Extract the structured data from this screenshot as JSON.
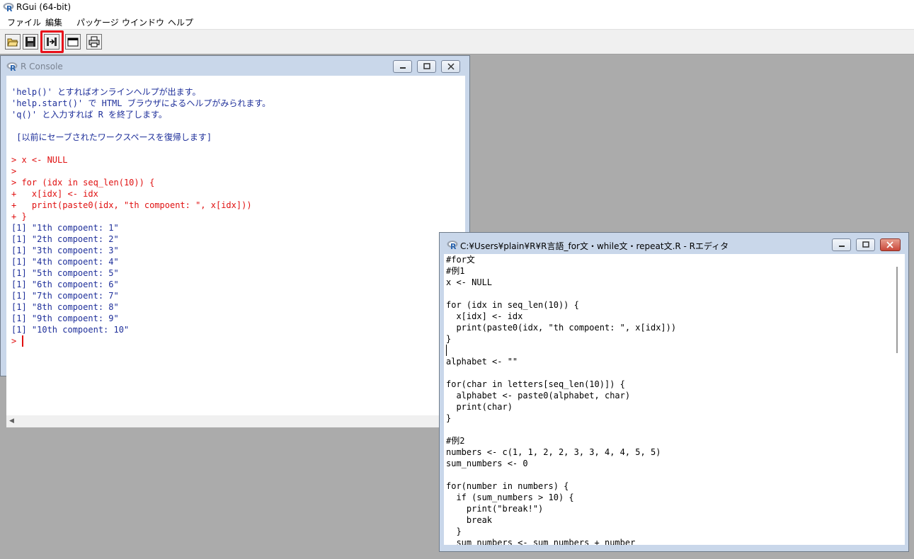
{
  "app": {
    "title": "RGui (64-bit)"
  },
  "menu": [
    "ファイル",
    "編集",
    "パッケージ",
    "ウインドウ",
    "ヘルプ"
  ],
  "toolbar": {
    "buttons": [
      "open-script",
      "save",
      "stop-computation",
      "window",
      "print"
    ],
    "highlighted": "stop-computation",
    "highlight_color": "#e8101a"
  },
  "console": {
    "title": "R Console",
    "lines": [
      {
        "text": "'help()' とすればオンラインヘルプが出ます。",
        "color": "blue"
      },
      {
        "text": "'help.start()' で HTML ブラウザによるヘルプがみられます。",
        "color": "blue"
      },
      {
        "text": "'q()' と入力すれば R を終了します。",
        "color": "blue"
      },
      {
        "text": "",
        "color": "blue"
      },
      {
        "text": " [以前にセーブされたワークスペースを復帰します]",
        "color": "blue"
      },
      {
        "text": "",
        "color": "blue"
      },
      {
        "text": "> x <- NULL",
        "color": "red"
      },
      {
        "text": ">",
        "color": "red"
      },
      {
        "text": "> for (idx in seq_len(10)) {",
        "color": "red"
      },
      {
        "text": "+   x[idx] <- idx",
        "color": "red"
      },
      {
        "text": "+   print(paste0(idx, \"th compoent: \", x[idx]))",
        "color": "red"
      },
      {
        "text": "+ }",
        "color": "red"
      },
      {
        "text": "[1] \"1th compoent: 1\"",
        "color": "blue"
      },
      {
        "text": "[1] \"2th compoent: 2\"",
        "color": "blue"
      },
      {
        "text": "[1] \"3th compoent: 3\"",
        "color": "blue"
      },
      {
        "text": "[1] \"4th compoent: 4\"",
        "color": "blue"
      },
      {
        "text": "[1] \"5th compoent: 5\"",
        "color": "blue"
      },
      {
        "text": "[1] \"6th compoent: 6\"",
        "color": "blue"
      },
      {
        "text": "[1] \"7th compoent: 7\"",
        "color": "blue"
      },
      {
        "text": "[1] \"8th compoent: 8\"",
        "color": "blue"
      },
      {
        "text": "[1] \"9th compoent: 9\"",
        "color": "blue"
      },
      {
        "text": "[1] \"10th compoent: 10\"",
        "color": "blue"
      },
      {
        "text": ">",
        "color": "red"
      }
    ]
  },
  "editor": {
    "title": "C:¥Users¥plain¥R¥R言語_for文・while文・repeat文.R - Rエディタ",
    "lines": [
      "#for文",
      "#例1",
      "x <- NULL",
      "",
      "for (idx in seq_len(10)) {",
      "  x[idx] <- idx",
      "  print(paste0(idx, \"th compoent: \", x[idx]))",
      "}",
      "",
      "alphabet <- \"\"",
      "",
      "for(char in letters[seq_len(10)]) {",
      "  alphabet <- paste0(alphabet, char)",
      "  print(char)",
      "}",
      "",
      "#例2",
      "numbers <- c(1, 1, 2, 2, 3, 3, 4, 4, 5, 5)",
      "sum_numbers <- 0",
      "",
      "for(number in numbers) {",
      "  if (sum_numbers > 10) {",
      "    print(\"break!\")",
      "    break",
      "  }",
      "  sum_numbers <- sum_numbers + number"
    ]
  },
  "colors": {
    "console_blue": "#1e2f9a",
    "console_red": "#e01010",
    "mdi_background": "#ababab"
  }
}
